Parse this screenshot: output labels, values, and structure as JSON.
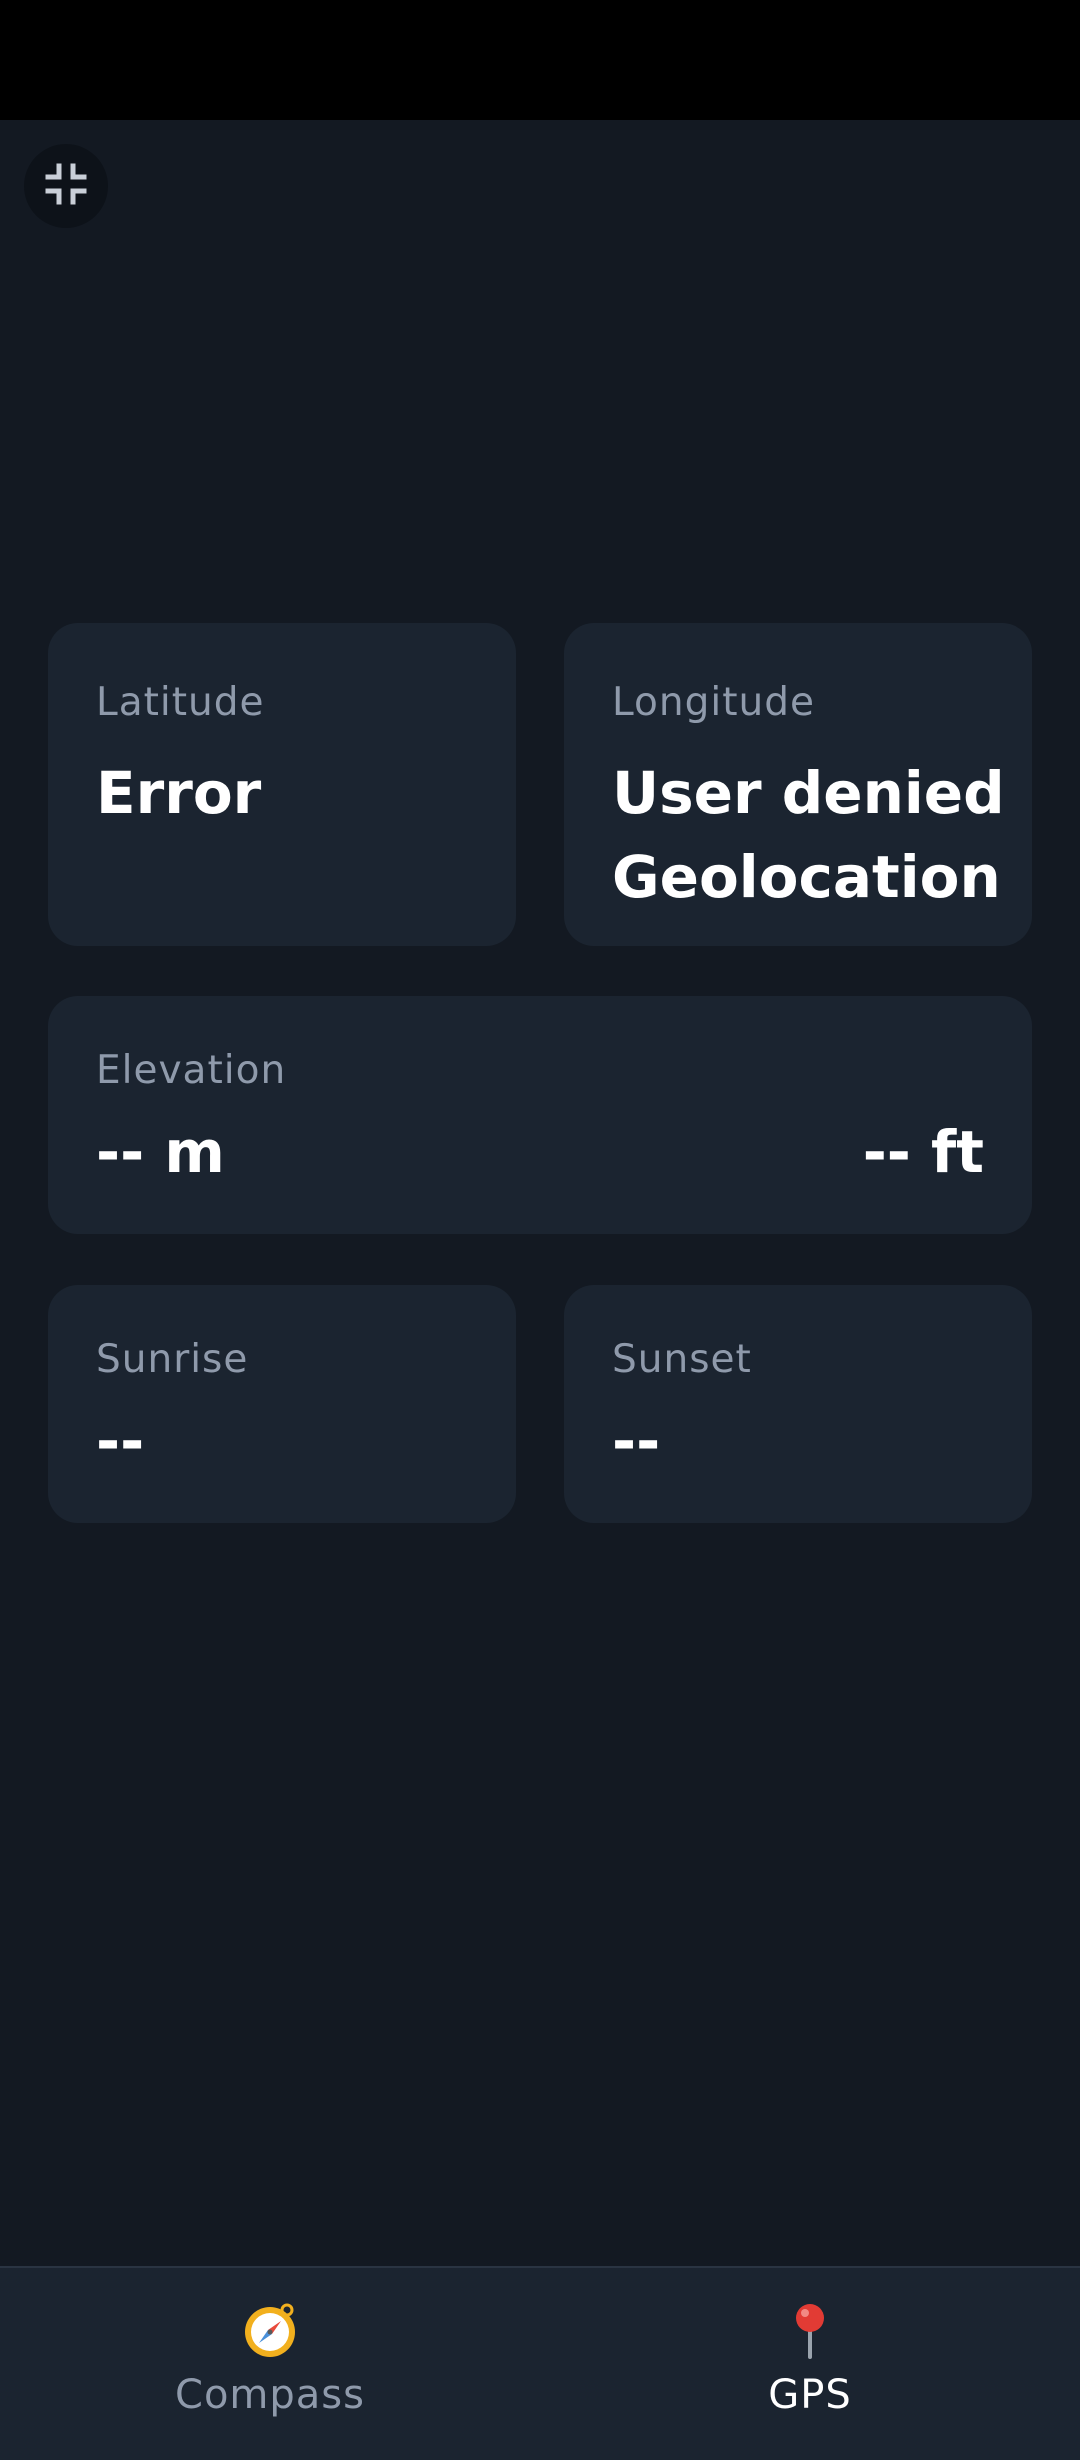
{
  "header": {
    "fullscreen_icon": "exit-fullscreen-icon"
  },
  "cards": {
    "latitude": {
      "label": "Latitude",
      "value": "Error"
    },
    "longitude": {
      "label": "Longitude",
      "value": "User denied Geolocation"
    },
    "elevation": {
      "label": "Elevation",
      "value_m": "-- m",
      "value_ft": "-- ft"
    },
    "sunrise": {
      "label": "Sunrise",
      "value": "--"
    },
    "sunset": {
      "label": "Sunset",
      "value": "--"
    }
  },
  "nav": {
    "compass": {
      "label": "Compass",
      "icon": "compass-icon",
      "active": false
    },
    "gps": {
      "label": "GPS",
      "icon": "pin-icon",
      "active": true
    }
  },
  "colors": {
    "background": "#131922",
    "card": "#1b2430",
    "label": "#8f9aab",
    "value": "#ffffff",
    "status_bar": "#000000"
  }
}
